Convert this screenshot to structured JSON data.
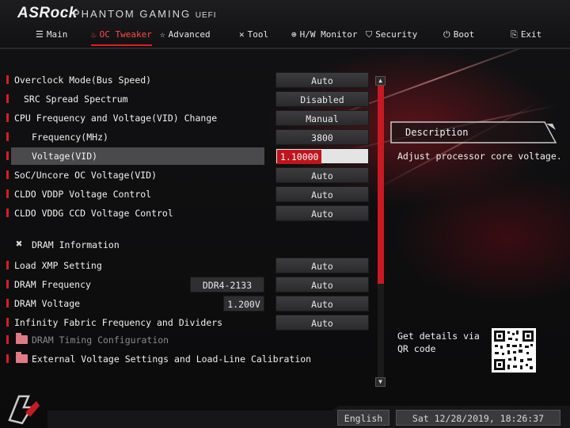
{
  "brand": {
    "name": "ASRock",
    "subtitle": "PHANTOM GAMING",
    "uefi": "UEFI"
  },
  "tabs": [
    {
      "label": "Main",
      "icon": "list-icon"
    },
    {
      "label": "OC Tweaker",
      "icon": "flame-icon",
      "active": true
    },
    {
      "label": "Advanced",
      "icon": "star-icon"
    },
    {
      "label": "Tool",
      "icon": "tool-icon"
    },
    {
      "label": "H/W Monitor",
      "icon": "monitor-icon"
    },
    {
      "label": "Security",
      "icon": "shield-icon"
    },
    {
      "label": "Boot",
      "icon": "power-icon"
    },
    {
      "label": "Exit",
      "icon": "exit-icon"
    }
  ],
  "settings": {
    "overclock_mode": {
      "label": "Overclock Mode(Bus Speed)",
      "value": "Auto"
    },
    "src_spread": {
      "label": "SRC Spread Spectrum",
      "value": "Disabled"
    },
    "cpu_freq_voltage": {
      "label": "CPU Frequency and Voltage(VID) Change",
      "value": "Manual"
    },
    "frequency": {
      "label": "Frequency(MHz)",
      "value": "3800"
    },
    "voltage_vid": {
      "label": "Voltage(VID)",
      "value": "1.10000"
    },
    "soc_uncore": {
      "label": "SoC/Uncore OC Voltage(VID)",
      "value": "Auto"
    },
    "cldo_vddp": {
      "label": "CLDO VDDP Voltage Control",
      "value": "Auto"
    },
    "cldo_vddg": {
      "label": "CLDO VDDG CCD Voltage Control",
      "value": "Auto"
    },
    "dram_info": {
      "label": "DRAM Information"
    },
    "load_xmp": {
      "label": "Load XMP Setting",
      "value": "Auto"
    },
    "dram_freq": {
      "label": "DRAM Frequency",
      "info": "DDR4-2133",
      "value": "Auto"
    },
    "dram_voltage": {
      "label": "DRAM Voltage",
      "info": "1.200V",
      "value": "Auto"
    },
    "infinity_fabric": {
      "label": "Infinity Fabric Frequency and Dividers",
      "value": "Auto"
    },
    "dram_timing": {
      "label": "DRAM Timing Configuration"
    },
    "ext_voltage": {
      "label": "External Voltage Settings and Load-Line Calibration"
    }
  },
  "description": {
    "title": "Description",
    "text": "Adjust processor core voltage.",
    "qr_text": "Get details via QR code"
  },
  "footer": {
    "language": "English",
    "datetime": "Sat 12/28/2019, 18:26:37"
  },
  "colors": {
    "accent": "#d41e24",
    "selected_row": "#4a4a4c"
  }
}
